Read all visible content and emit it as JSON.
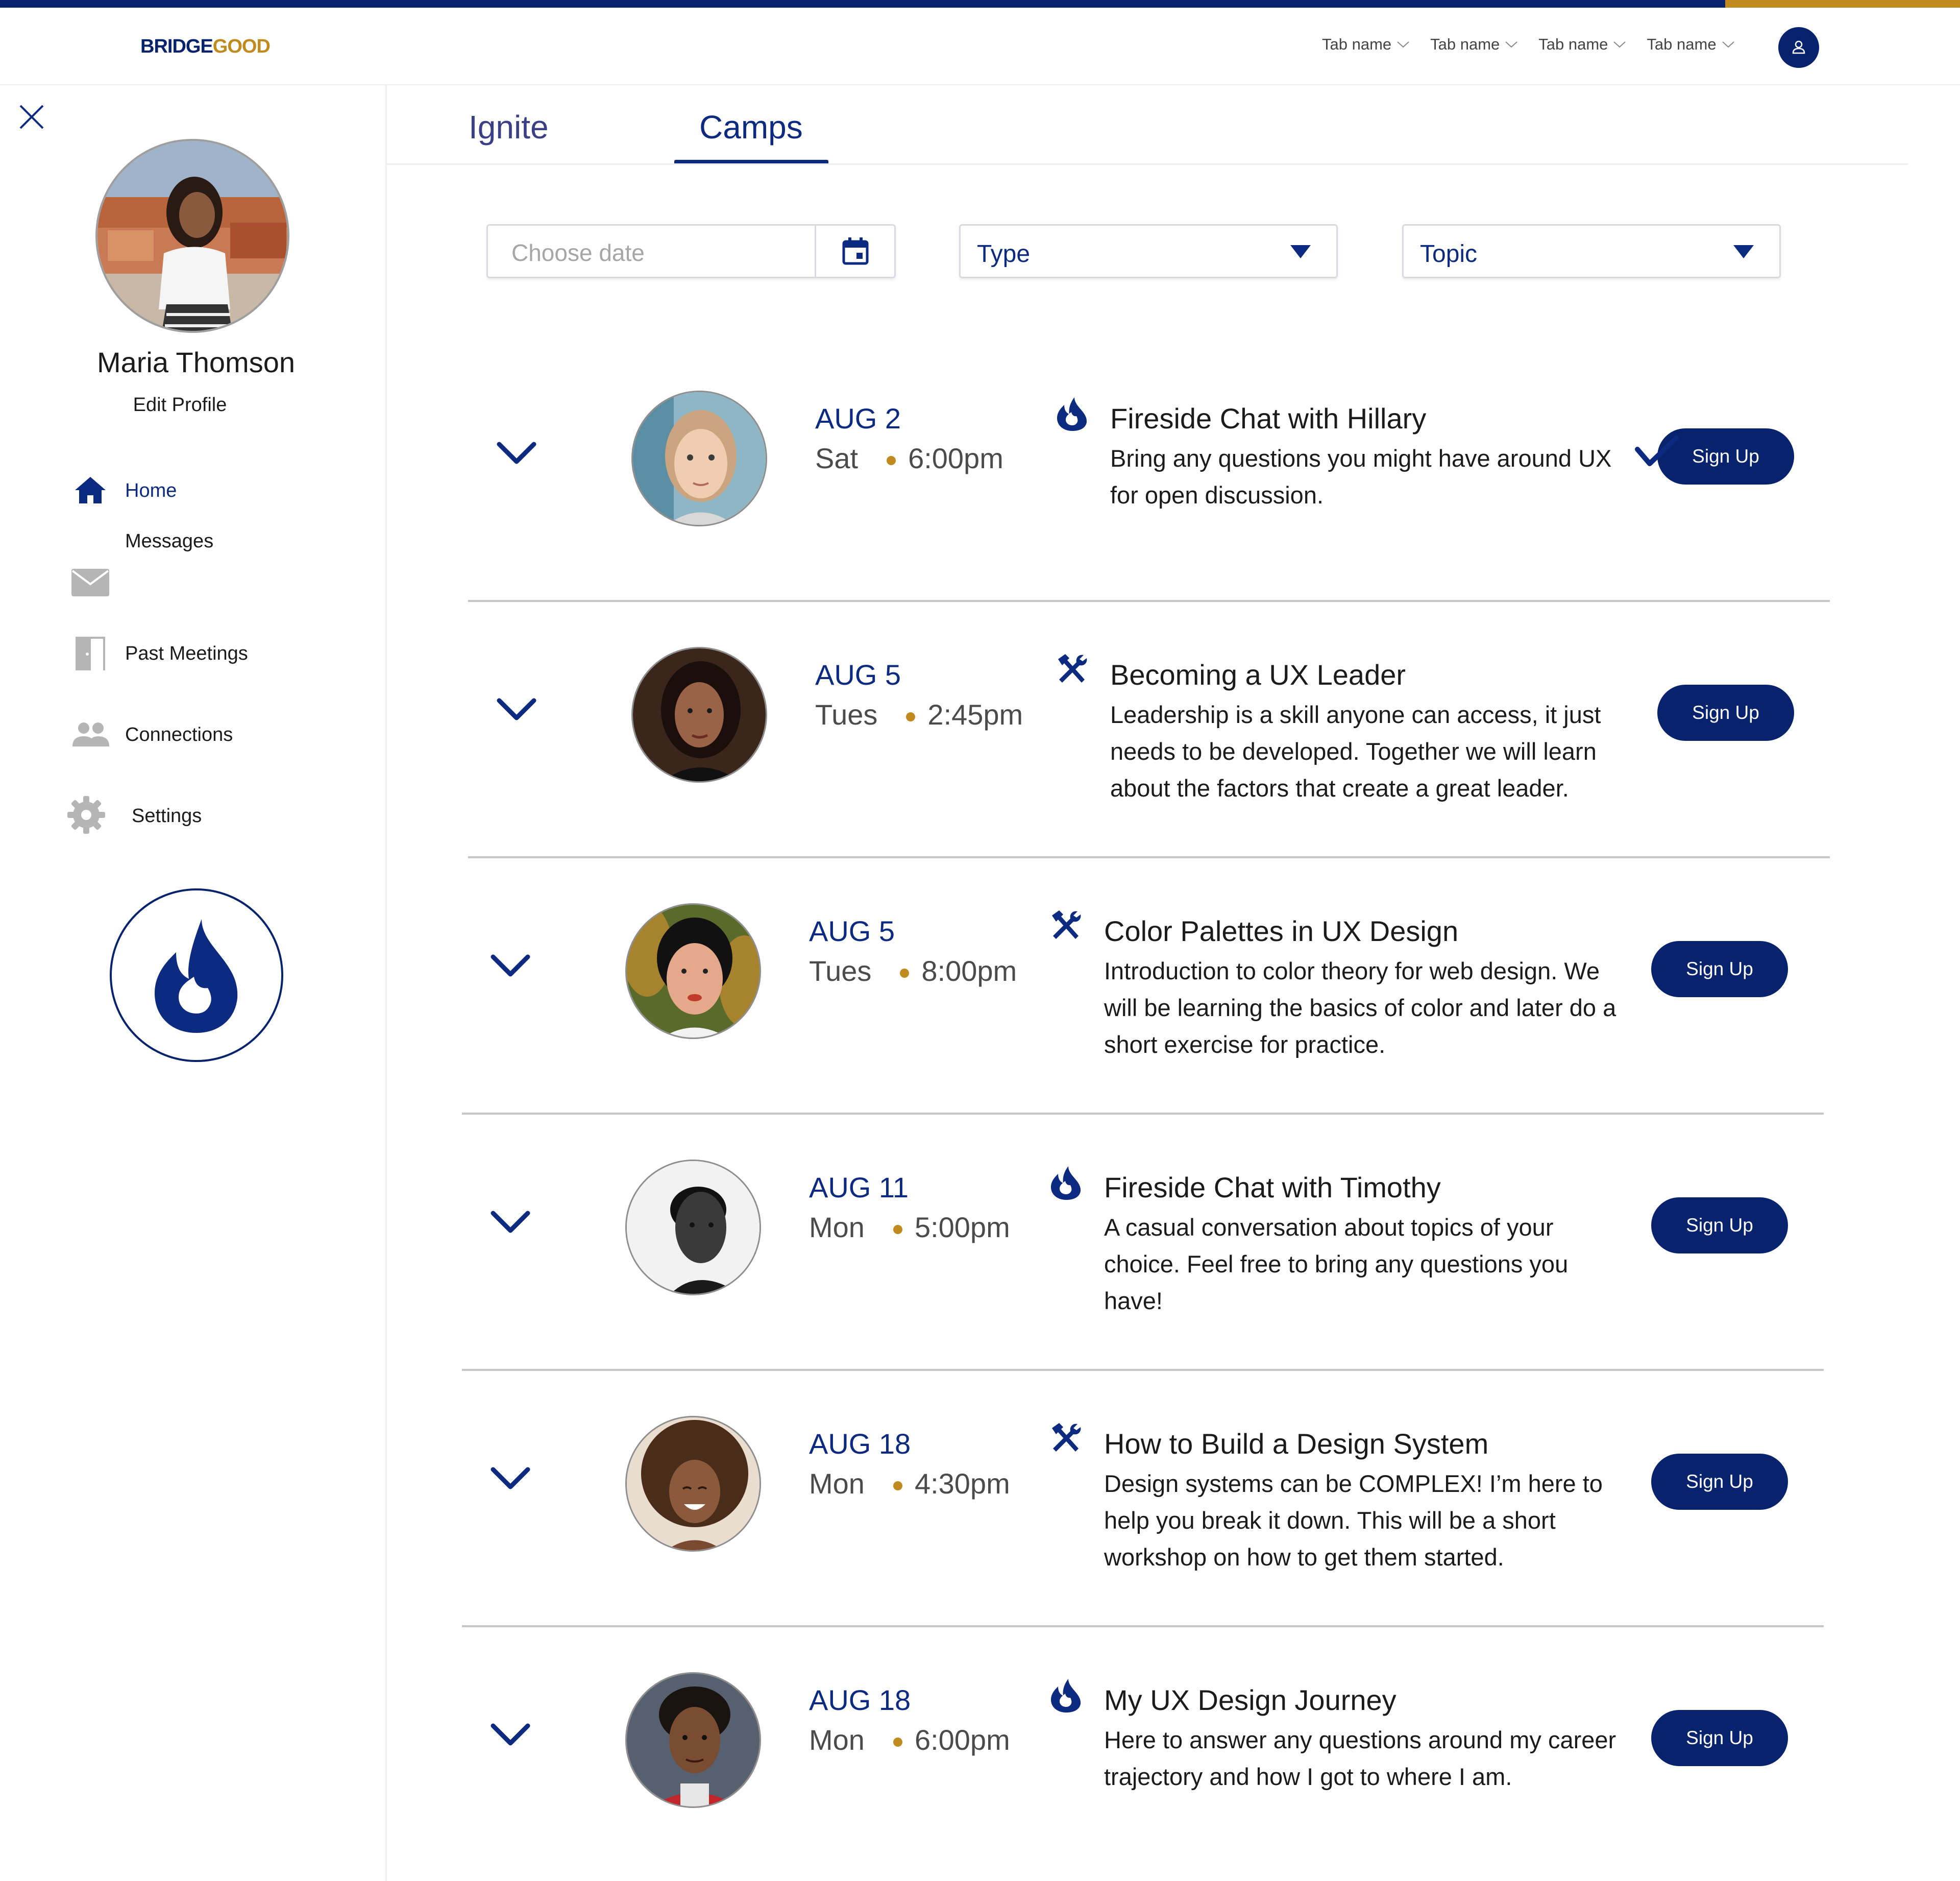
{
  "brand": {
    "logo_part1": "BRIDGE",
    "logo_part2": "GOOD",
    "navy": "#0b2a80",
    "gold": "#c08a1e"
  },
  "topnav": {
    "tabs": [
      {
        "label": "Tab name"
      },
      {
        "label": "Tab name"
      },
      {
        "label": "Tab name"
      },
      {
        "label": "Tab name"
      }
    ],
    "account_icon": "user-icon"
  },
  "sidebar": {
    "profile_name": "Maria Thomson",
    "edit_profile": "Edit Profile",
    "items": [
      {
        "label": "Home",
        "icon": "home-icon",
        "active": true
      },
      {
        "label": "Messages",
        "icon": "mail-icon"
      },
      {
        "label": "Past Meetings",
        "icon": "door-icon"
      },
      {
        "label": "Connections",
        "icon": "people-icon"
      },
      {
        "label": "Settings",
        "icon": "gear-icon"
      }
    ],
    "badge_icon": "flame-icon"
  },
  "main": {
    "tabs": [
      {
        "label": "Ignite"
      },
      {
        "label": "Camps",
        "active": true
      }
    ],
    "filters": {
      "date_placeholder": "Choose date",
      "type_label": "Type",
      "topic_label": "Topic"
    },
    "events": [
      {
        "date": "AUG 2",
        "day": "Sat",
        "time": "6:00pm",
        "type_icon": "flame-icon",
        "title": "Fireside Chat with Hillary",
        "description": "Bring any questions you might have around UX for open discussion.",
        "button": "Sign Up",
        "signed_up": true
      },
      {
        "date": "AUG 5",
        "day": "Tues",
        "time": "2:45pm",
        "type_icon": "tools-icon",
        "title": "Becoming a UX Leader",
        "description": "Leadership is a skill anyone can access, it just needs to be developed. Together we will learn about the factors that create a great leader.",
        "button": "Sign Up"
      },
      {
        "date": "AUG 5",
        "day": "Tues",
        "time": "8:00pm",
        "type_icon": "tools-icon",
        "title": "Color Palettes in UX Design",
        "description": "Introduction to color theory for web design. We will be learning the basics of color and later do a short exercise for practice.",
        "button": "Sign Up"
      },
      {
        "date": "AUG 11",
        "day": "Mon",
        "time": "5:00pm",
        "type_icon": "flame-icon",
        "title": "Fireside Chat with Timothy",
        "description": "A casual conversation about topics of your choice. Feel free to bring any questions you have!",
        "button": "Sign Up"
      },
      {
        "date": "AUG 18",
        "day": "Mon",
        "time": "4:30pm",
        "type_icon": "tools-icon",
        "title": "How to Build a Design System",
        "description": "Design systems can be COMPLEX! I’m here to help you break it down. This will be a short workshop on how to get them started.",
        "button": "Sign Up"
      },
      {
        "date": "AUG 18",
        "day": "Mon",
        "time": "6:00pm",
        "type_icon": "flame-icon",
        "title": "My UX Design Journey",
        "description": "Here to answer any questions around my career trajectory and how I got to where I am.",
        "button": "Sign Up"
      }
    ]
  }
}
